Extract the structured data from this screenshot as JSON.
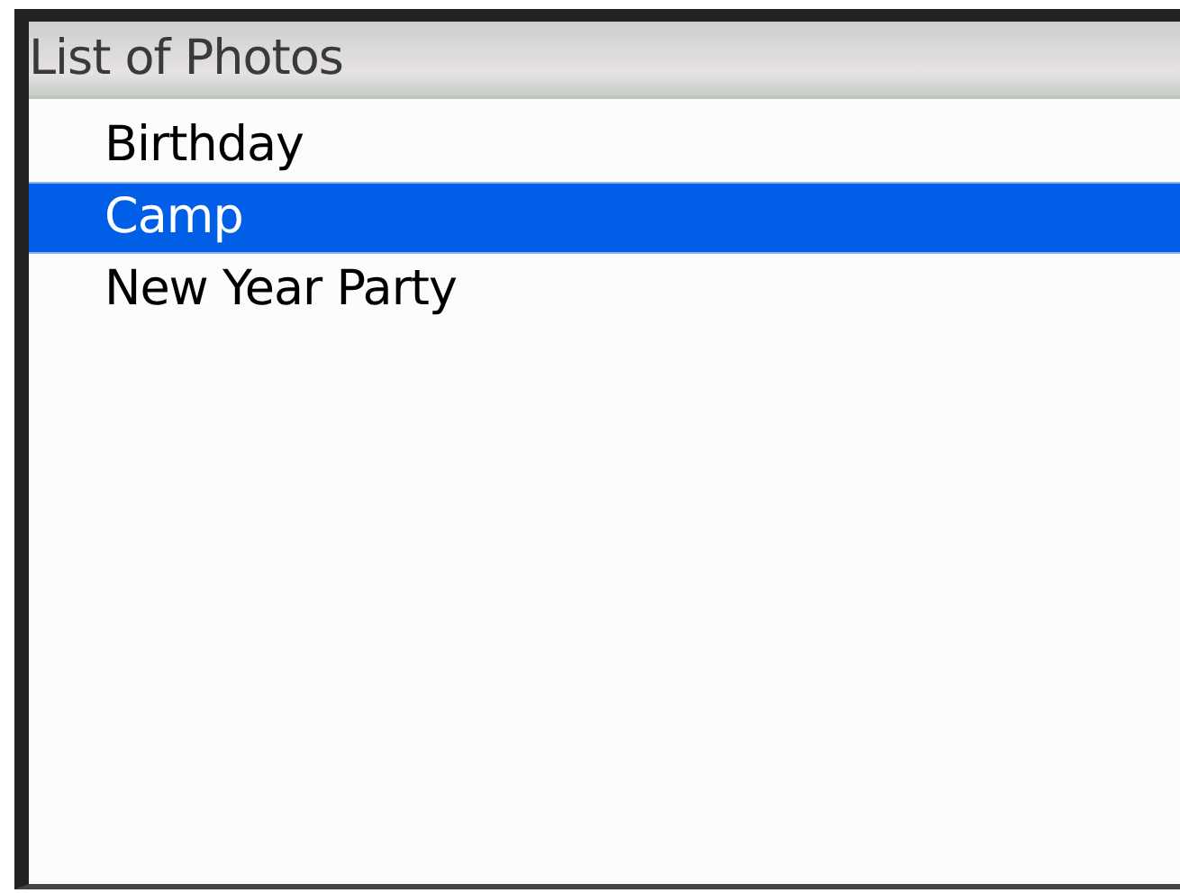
{
  "window": {
    "title": "List of Photos"
  },
  "items": [
    {
      "label": "Birthday",
      "selected": false
    },
    {
      "label": "Camp",
      "selected": true
    },
    {
      "label": "New Year Party",
      "selected": false
    }
  ]
}
